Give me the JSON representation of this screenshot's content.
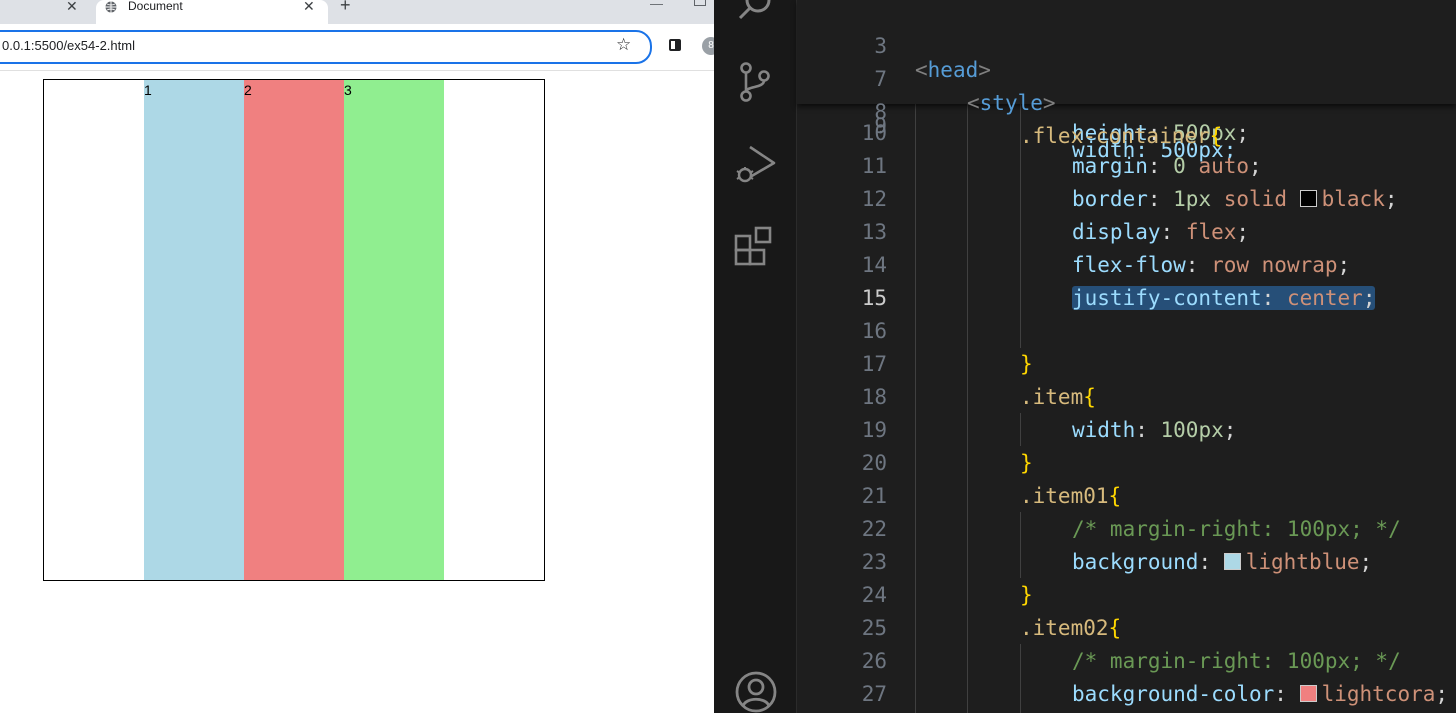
{
  "browser": {
    "tab_title": "Document",
    "tab_close": "✕",
    "prev_tab_close": "✕",
    "new_tab": "+",
    "url": "0.0.1:5500/ex54-2.html",
    "star": "☆",
    "ext_badge": "8"
  },
  "page": {
    "items": [
      {
        "label": "1",
        "color": "#add8e6"
      },
      {
        "label": "2",
        "color": "#f08080"
      },
      {
        "label": "3",
        "color": "#90ee90"
      }
    ]
  },
  "editor": {
    "sticky": [
      {
        "num": "3",
        "text": "<head>"
      },
      {
        "num": "7",
        "text": "<style>"
      },
      {
        "num": "8",
        "text": ".flex-container{"
      }
    ],
    "hidden_line": {
      "num": "9",
      "text": "width: 500px;"
    },
    "lines": [
      {
        "num": "10",
        "prop": "height",
        "value": "500px",
        "kind": "num"
      },
      {
        "num": "11",
        "prop": "margin",
        "value_num": "0",
        "value": "auto",
        "kind": "mixed"
      },
      {
        "num": "12",
        "prop": "border",
        "value_num": "1px",
        "value": "solid",
        "color_name": "black",
        "kind": "border"
      },
      {
        "num": "13",
        "prop": "display",
        "value": "flex",
        "kind": "val"
      },
      {
        "num": "14",
        "prop": "flex-flow",
        "value": "row nowrap",
        "kind": "val"
      },
      {
        "num": "15",
        "prop": "justify-content",
        "value": "center",
        "kind": "val"
      },
      {
        "num": "16"
      },
      {
        "num": "17",
        "text": "}"
      },
      {
        "num": "18",
        "text": ".item{"
      },
      {
        "num": "19",
        "prop": "width",
        "value": "100px",
        "kind": "num"
      },
      {
        "num": "20",
        "text": "}"
      },
      {
        "num": "21",
        "text": ".item01{"
      },
      {
        "num": "22",
        "comment": "/* margin-right: 100px; */"
      },
      {
        "num": "23",
        "prop": "background",
        "color_name": "lightblue",
        "swatch": "#add8e6"
      },
      {
        "num": "24",
        "text": "}"
      },
      {
        "num": "25",
        "text": ".item02{"
      },
      {
        "num": "26",
        "comment": "/* margin-right: 100px; */"
      },
      {
        "num": "27",
        "prop": "background-color",
        "color_name": "lightcora",
        "swatch": "#f08080"
      }
    ]
  }
}
